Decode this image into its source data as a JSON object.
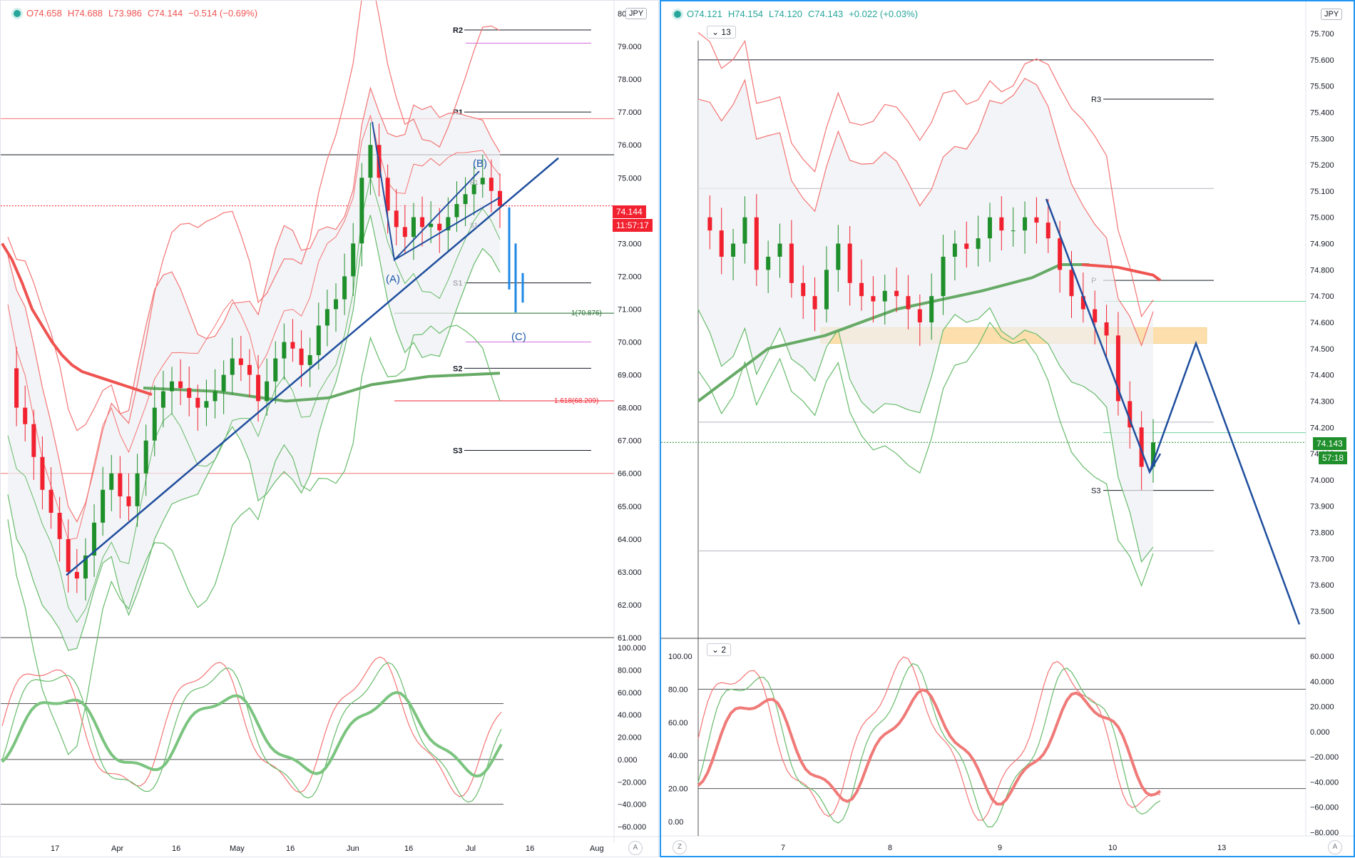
{
  "colors": {
    "up": "#26a69a",
    "down": "#ef5350",
    "candle_up": "#1e8f2a",
    "candle_down": "#f2212f",
    "trend": "#1f4e9e",
    "wave": "#1e88e5",
    "band_red": "#f47373",
    "band_green": "#66bb6a",
    "ma_red": "#ef5350",
    "ma_green": "#66aa66",
    "zone": "#fbc66a"
  },
  "left_chart": {
    "legend": {
      "open": "O74.658",
      "high": "H74.688",
      "low": "L73.986",
      "close": "C74.144",
      "change": "−0.514 (−0.69%)"
    },
    "currency": "JPY",
    "price_tag": "74.144",
    "countdown_tag": "11:57:17",
    "corner_label": "A",
    "chart_data": {
      "type": "candlestick",
      "y_axis": {
        "min": 61.0,
        "max": 80.0,
        "ticks": [
          "80.000",
          "79.000",
          "78.000",
          "77.000",
          "76.000",
          "75.000",
          "74.000",
          "73.000",
          "72.000",
          "71.000",
          "70.000",
          "69.000",
          "68.000",
          "67.000",
          "66.000",
          "65.000",
          "64.000",
          "63.000",
          "62.000",
          "61.000"
        ]
      },
      "x_ticks": [
        "17",
        "Apr",
        "16",
        "May",
        "16",
        "Jun",
        "16",
        "Jul",
        "16",
        "Aug"
      ],
      "close_path": [
        69.2,
        68.0,
        67.5,
        66.5,
        65.5,
        64.8,
        64.0,
        63.0,
        62.8,
        63.5,
        64.5,
        65.5,
        66.0,
        65.3,
        65.0,
        66.0,
        67.0,
        68.0,
        68.5,
        68.8,
        68.6,
        68.3,
        68.0,
        68.2,
        68.5,
        69.0,
        69.5,
        69.3,
        69.0,
        68.2,
        68.8,
        69.5,
        70.0,
        69.8,
        69.3,
        69.6,
        70.5,
        71.0,
        71.3,
        72.0,
        73.0,
        75.0,
        76.0,
        75.0,
        74.0,
        73.5,
        73.2,
        73.8,
        73.5,
        73.6,
        73.4,
        73.8,
        74.2,
        74.5,
        74.8,
        75.0,
        74.6,
        74.144
      ],
      "levels": [
        {
          "label": "R2",
          "value": 79.5
        },
        {
          "label": "R1",
          "value": 77.0
        },
        {
          "label": "S1",
          "value": 71.8
        },
        {
          "label": "S2",
          "value": 69.2
        },
        {
          "label": "S3",
          "value": 66.7
        }
      ],
      "fib_labels": [
        "1(70.876)",
        "1.618(68.209)"
      ],
      "wave_labels": [
        "(A)",
        "(B)",
        "(C)"
      ],
      "mini_pivots": [
        "R1",
        "S1"
      ]
    },
    "osc": {
      "ticks": [
        "100.000",
        "80.000",
        "60.000",
        "40.000",
        "20.000",
        "0.000",
        "−20.000",
        "−40.000",
        "−60.000"
      ]
    }
  },
  "right_chart": {
    "legend": {
      "open": "O74.121",
      "high": "H74.154",
      "low": "L74.120",
      "close": "C74.143",
      "change": "+0.022 (+0.03%)"
    },
    "currency": "JPY",
    "indicator_badge": "13",
    "osc_badge": "2",
    "price_tag": "74.143",
    "countdown_tag": "57:18",
    "corner_left": "Z",
    "corner_right": "A",
    "chart_data": {
      "type": "candlestick",
      "y_axis": {
        "min": 73.5,
        "max": 75.7,
        "ticks": [
          "75.700",
          "75.600",
          "75.500",
          "75.400",
          "75.300",
          "75.200",
          "75.100",
          "75.000",
          "74.900",
          "74.800",
          "74.700",
          "74.600",
          "74.500",
          "74.400",
          "74.300",
          "74.200",
          "74.100",
          "74.000",
          "73.900",
          "73.800",
          "73.700",
          "73.600",
          "73.500"
        ]
      },
      "x_ticks": [
        "7",
        "8",
        "9",
        "10",
        "13"
      ],
      "close_path": [
        75.0,
        74.95,
        74.85,
        74.9,
        75.0,
        74.8,
        74.85,
        74.9,
        74.75,
        74.7,
        74.65,
        74.8,
        74.9,
        74.75,
        74.7,
        74.68,
        74.72,
        74.7,
        74.65,
        74.6,
        74.7,
        74.85,
        74.9,
        74.88,
        74.92,
        75.0,
        74.95,
        74.95,
        75.0,
        74.98,
        74.92,
        74.8,
        74.7,
        74.65,
        74.6,
        74.55,
        74.3,
        74.2,
        74.05,
        74.143
      ],
      "levels": [
        {
          "label": "R3",
          "value": 75.45
        },
        {
          "label": "P",
          "value": 74.76
        },
        {
          "label": "S3",
          "value": 73.96
        }
      ],
      "zone": {
        "from": 74.52,
        "to": 74.58
      },
      "projection": [
        74.03,
        74.52,
        73.45
      ]
    },
    "osc": {
      "left_ticks": [
        "100.00",
        "80.00",
        "60.00",
        "40.00",
        "20.00",
        "0.00"
      ],
      "right_ticks": [
        "60.000",
        "40.000",
        "20.000",
        "0.000",
        "−20.000",
        "−40.000",
        "−60.000",
        "−80.000"
      ]
    }
  }
}
